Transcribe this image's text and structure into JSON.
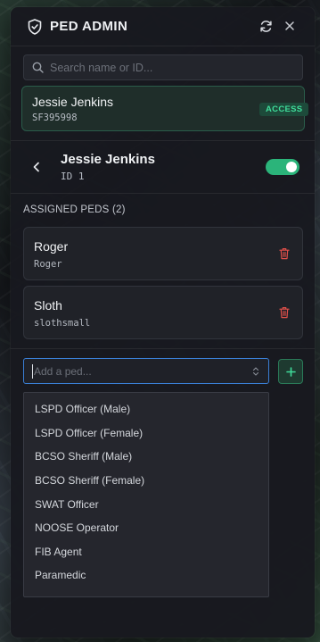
{
  "header": {
    "title": "PED ADMIN",
    "icons": {
      "logo": "shield-icon",
      "refresh": "refresh-icon",
      "close": "close-icon"
    }
  },
  "search": {
    "placeholder": "Search name or ID...",
    "value": ""
  },
  "player": {
    "name": "Jessie Jenkins",
    "identifier": "SF395998",
    "badge": "ACCESS"
  },
  "detail": {
    "name": "Jessie Jenkins",
    "id_text": "ID 1",
    "enabled": true
  },
  "assigned": {
    "label": "ASSIGNED PEDS (2)",
    "peds": [
      {
        "name": "Roger",
        "model": "Roger"
      },
      {
        "name": "Sloth",
        "model": "slothsmall"
      }
    ]
  },
  "add": {
    "placeholder": "Add a ped...",
    "value": "",
    "options": [
      "LSPD Officer (Male)",
      "LSPD Officer (Female)",
      "BCSO Sheriff (Male)",
      "BCSO Sheriff (Female)",
      "SWAT Officer",
      "NOOSE Operator",
      "FIB Agent",
      "Paramedic"
    ]
  },
  "colors": {
    "accent_green": "#2bb47a",
    "badge_text": "#3fdc9a",
    "focus_blue": "#3a7fd6",
    "danger": "#e0504a"
  }
}
